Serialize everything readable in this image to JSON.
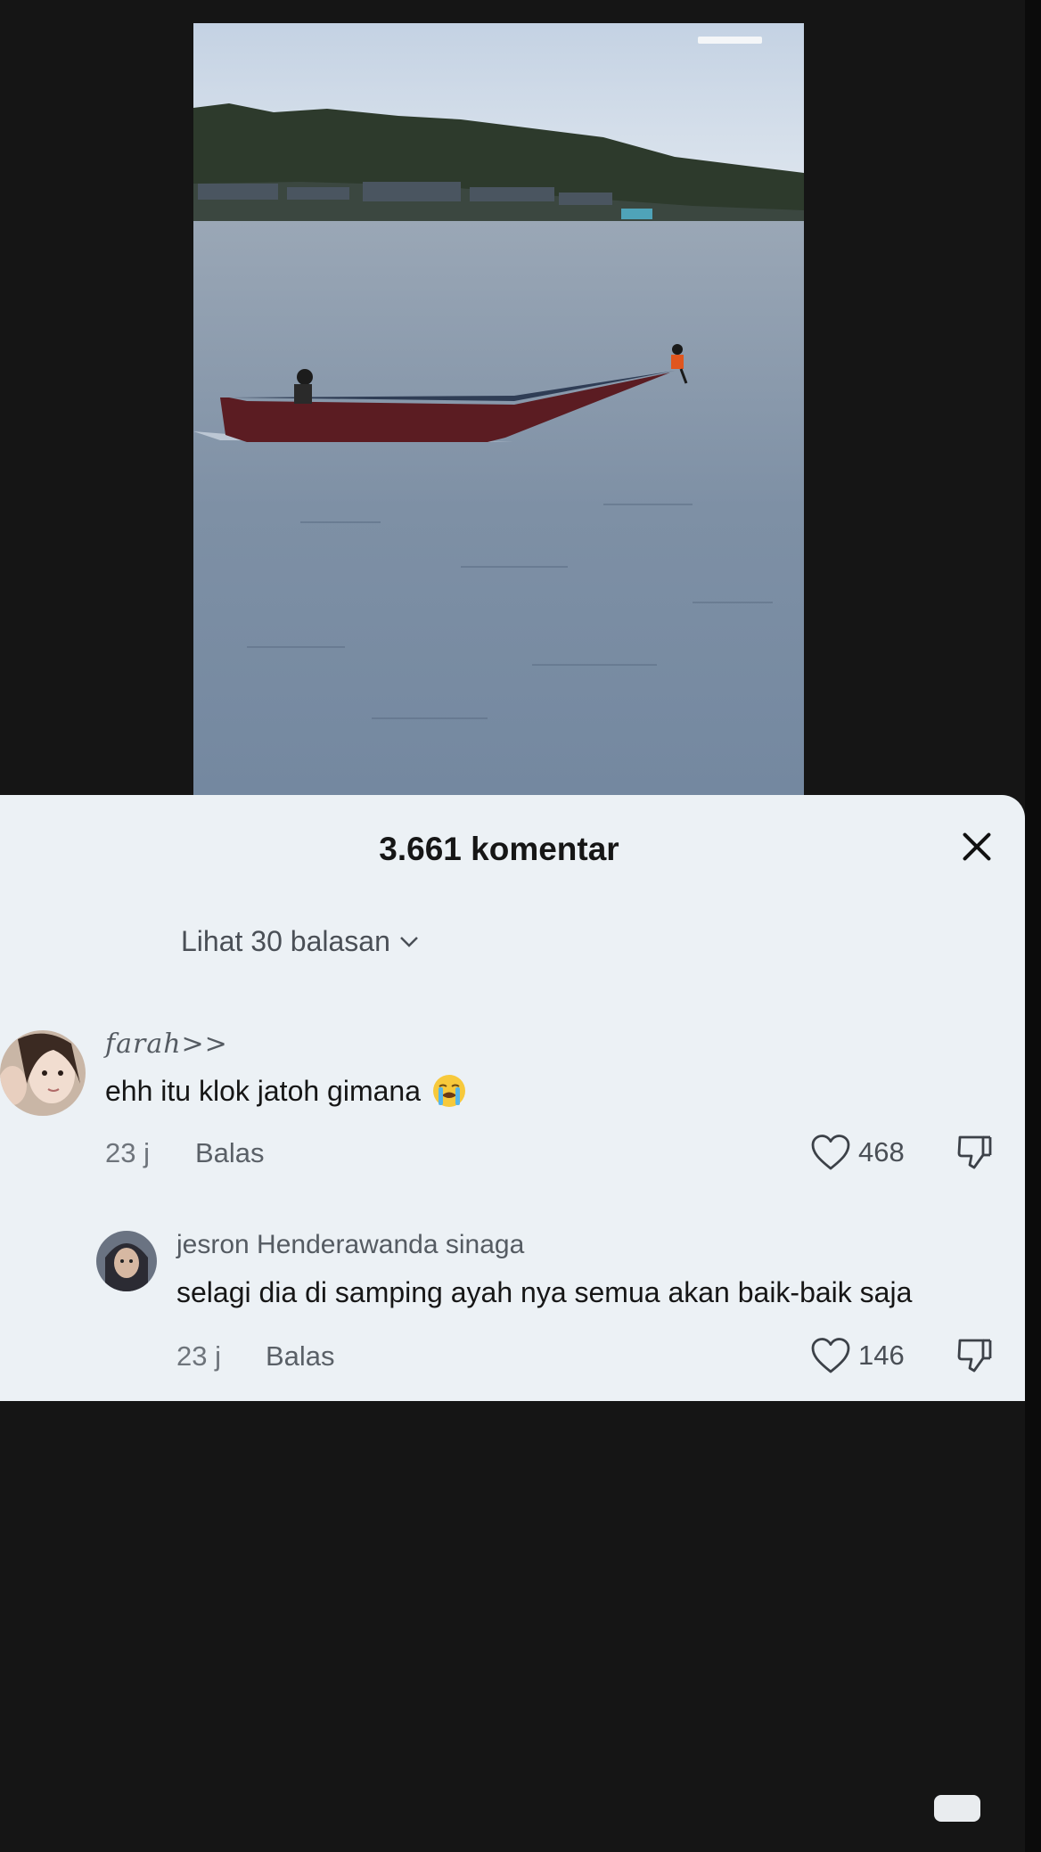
{
  "sheet": {
    "title": "3.661 komentar",
    "view_replies": "Lihat 30 balasan"
  },
  "comments": [
    {
      "username": "farah>>",
      "text": "ehh itu klok jatoh gimana",
      "emoji": "loudly-crying-face",
      "time": "23 j",
      "reply_label": "Balas",
      "likes": "468"
    },
    {
      "username": "jesron Henderawanda sinaga",
      "text": "selagi dia di samping ayah nya semua akan baik-baik saja",
      "time": "23 j",
      "reply_label": "Balas",
      "likes": "146"
    }
  ],
  "icons": {
    "close": "close-icon",
    "like": "heart-icon",
    "dislike": "thumbs-down-icon",
    "expand": "chevron-down-icon"
  },
  "colors": {
    "sheet_bg": "#ecf1f5",
    "page_bg": "#151515"
  }
}
